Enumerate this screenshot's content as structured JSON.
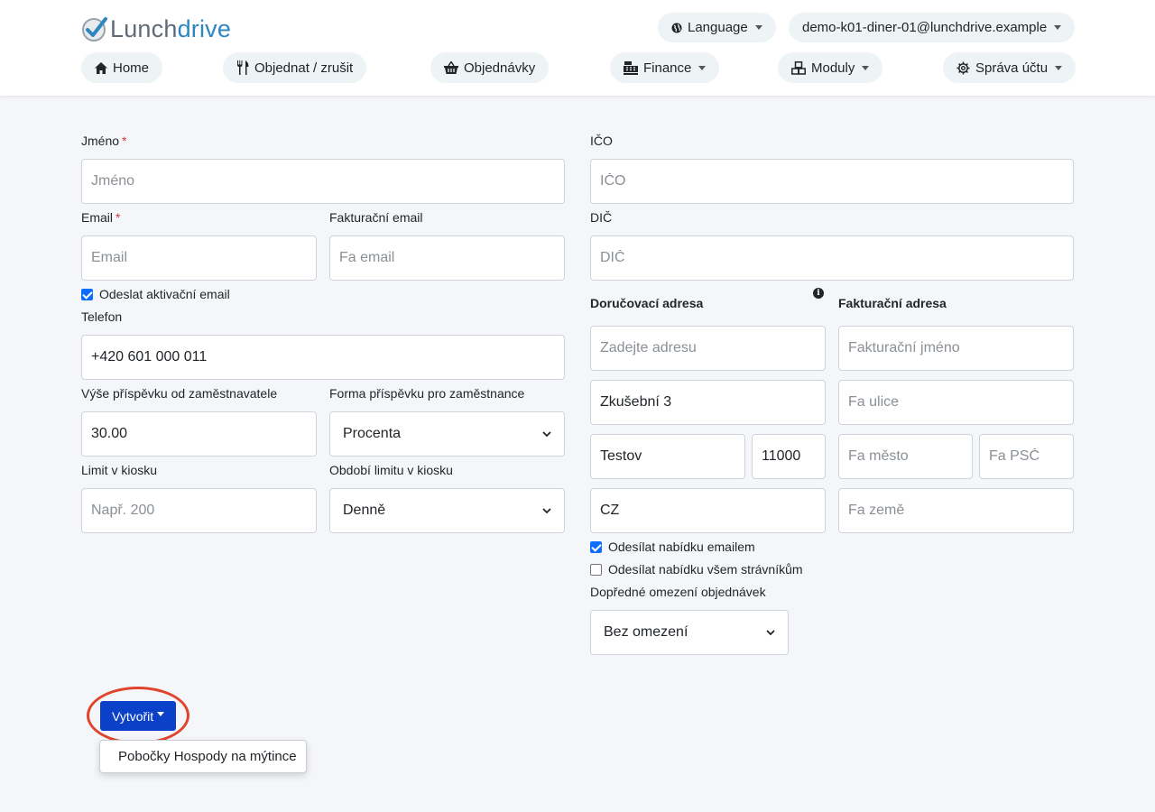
{
  "header": {
    "logo": {
      "part1": "Lunch",
      "part2": "drive"
    },
    "language_label": "Language",
    "user_email": "demo-k01-diner-01@lunchdrive.example",
    "nav": [
      {
        "label": "Home",
        "icon": "home-icon"
      },
      {
        "label": "Objednat / zrušit",
        "icon": "utensils-icon"
      },
      {
        "label": "Objednávky",
        "icon": "basket-icon"
      },
      {
        "label": "Finance",
        "icon": "cash-register-icon"
      },
      {
        "label": "Moduly",
        "icon": "cubes-icon"
      },
      {
        "label": "Správa účtu",
        "icon": "gear-icon"
      }
    ]
  },
  "form": {
    "left": {
      "name": {
        "label": "Jméno",
        "placeholder": "Jméno",
        "required_mark": "*"
      },
      "email": {
        "label": "Email",
        "placeholder": "Email",
        "required_mark": "*"
      },
      "invoice_email": {
        "label": "Fakturační email",
        "placeholder": "Fa email"
      },
      "send_activation": {
        "label": "Odeslat aktivační email",
        "checked": true
      },
      "phone": {
        "label": "Telefon",
        "value": "+420 601 000 011"
      },
      "employer_contribution": {
        "label": "Výše příspěvku od zaměstnavatele",
        "value": "30.00"
      },
      "contribution_form": {
        "label": "Forma příspěvku pro zaměstnance",
        "selected": "Procenta"
      },
      "kiosk_limit": {
        "label": "Limit v kiosku",
        "placeholder": "Např. 200"
      },
      "kiosk_period": {
        "label": "Období limitu v kiosku",
        "selected": "Denně"
      }
    },
    "right": {
      "ico": {
        "label": "IČO",
        "placeholder": "IČO"
      },
      "dic": {
        "label": "DIČ",
        "placeholder": "DIČ"
      },
      "delivery": {
        "heading": "Doručovací adresa",
        "address_placeholder": "Zadejte adresu",
        "street": "Zkušební 3",
        "city": "Testov",
        "zip": "11000",
        "country": "CZ"
      },
      "billing": {
        "heading": "Fakturační adresa",
        "name_placeholder": "Fakturační jméno",
        "street_placeholder": "Fa ulice",
        "city_placeholder": "Fa město",
        "zip_placeholder": "Fa PSČ",
        "country_placeholder": "Fa země"
      },
      "send_menu_email": {
        "label": "Odesílat nabídku emailem",
        "checked": true
      },
      "send_menu_all": {
        "label": "Odesílat nabídku všem strávníkům",
        "checked": false
      },
      "order_limit": {
        "label": "Dopředné omezení objednávek",
        "selected": "Bez omezení"
      }
    }
  },
  "actions": {
    "create_label": "Vytvořit",
    "dropdown_items": [
      "Pobočky Hospody na mýtince"
    ],
    "highlight_color": "#e0442c",
    "button_color": "#0b40c8"
  }
}
